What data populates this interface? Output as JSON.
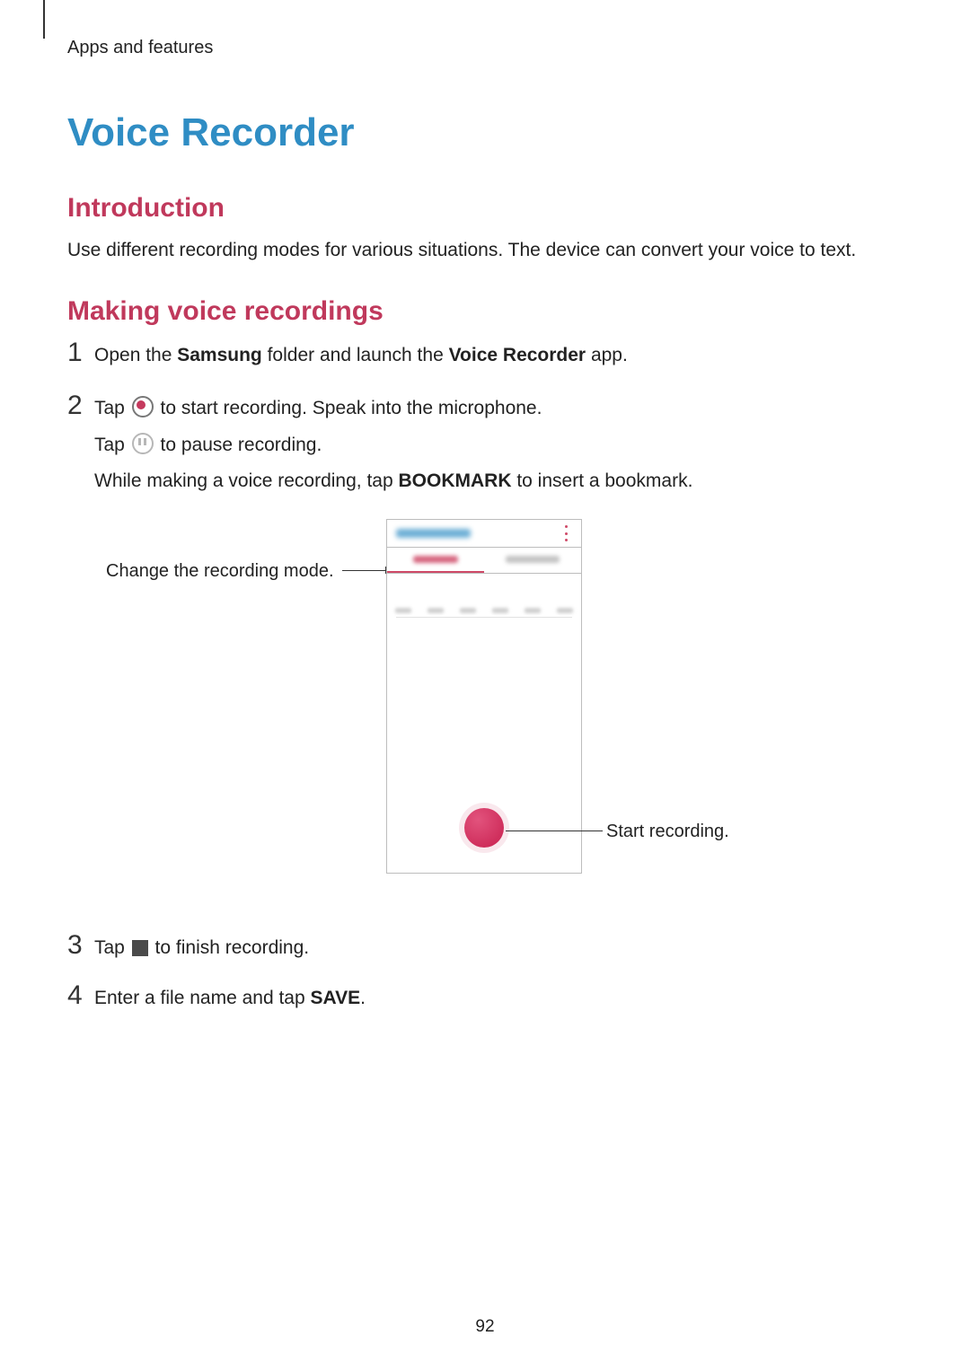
{
  "breadcrumb": "Apps and features",
  "title": "Voice Recorder",
  "sections": {
    "intro_heading": "Introduction",
    "intro_body": "Use different recording modes for various situations. The device can convert your voice to text.",
    "making_heading": "Making voice recordings"
  },
  "steps": {
    "s1": {
      "num": "1",
      "open_a": "Open the ",
      "samsung": "Samsung",
      "open_b": " folder and launch the ",
      "vr": "Voice Recorder",
      "open_c": " app."
    },
    "s2": {
      "num": "2",
      "l1a": "Tap ",
      "l1b": " to start recording. Speak into the microphone.",
      "l2a": "Tap ",
      "l2b": " to pause recording.",
      "l3a": "While making a voice recording, tap ",
      "bookmark": "BOOKMARK",
      "l3b": " to insert a bookmark."
    },
    "s3": {
      "num": "3",
      "a": "Tap ",
      "b": " to finish recording."
    },
    "s4": {
      "num": "4",
      "a": "Enter a file name and tap ",
      "save": "SAVE",
      "b": "."
    }
  },
  "callouts": {
    "left": "Change the recording mode.",
    "right": "Start recording."
  },
  "page_number": "92"
}
